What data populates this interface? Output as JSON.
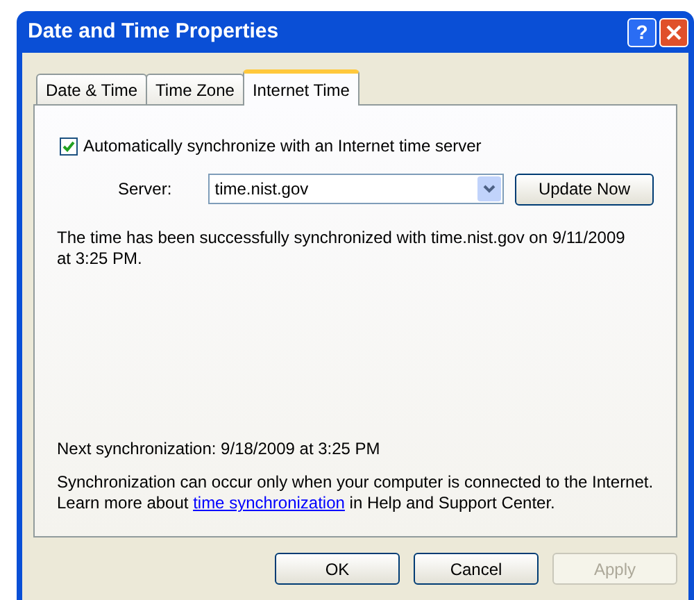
{
  "window": {
    "title": "Date and Time Properties",
    "help_glyph": "?"
  },
  "tabs": [
    {
      "label": "Date & Time",
      "selected": false
    },
    {
      "label": "Time Zone",
      "selected": false
    },
    {
      "label": "Internet Time",
      "selected": true
    }
  ],
  "auto_sync": {
    "label": "Automatically synchronize with an Internet time server",
    "checked": true
  },
  "server": {
    "label": "Server:",
    "value": "time.nist.gov"
  },
  "update_button": {
    "label": "Update Now",
    "disabled": false
  },
  "status_message": "The time has been successfully synchronized with time.nist.gov on 9/11/2009 at 3:25 PM.",
  "next_sync": "Next synchronization: 9/18/2009 at 3:25 PM",
  "help_text": {
    "before": "Synchronization can occur only when your computer is connected to the Internet.  Learn more about ",
    "link": "time synchronization",
    "after": " in Help and Support Center."
  },
  "buttons": [
    {
      "label": "OK",
      "disabled": false
    },
    {
      "label": "Cancel",
      "disabled": false
    },
    {
      "label": "Apply",
      "disabled": true
    }
  ]
}
